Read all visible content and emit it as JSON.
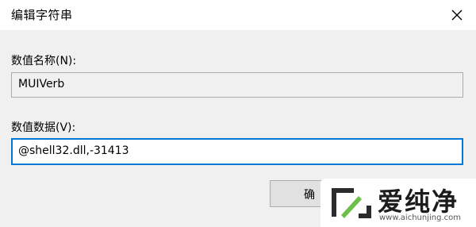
{
  "window": {
    "title": "编辑字符串",
    "close_icon": "close-icon"
  },
  "fields": {
    "value_name_label": "数值名称(N):",
    "value_name": "MUIVerb",
    "value_data_label": "数值数据(V):",
    "value_data": "@shell32.dll,-31413"
  },
  "buttons": {
    "ok_label": "确"
  },
  "watermark": {
    "brand": "爱纯净",
    "url": "www.aichunjing.com"
  },
  "colors": {
    "accent": "#0078d7",
    "background": "#f0f0f0"
  }
}
